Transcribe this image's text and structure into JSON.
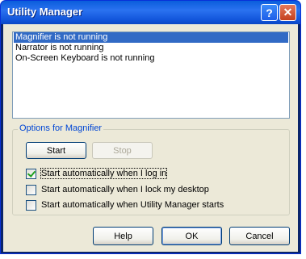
{
  "window": {
    "title": "Utility Manager",
    "help_glyph": "?",
    "close_glyph": "✕"
  },
  "list": {
    "items": [
      "Magnifier is not running",
      "Narrator is not running",
      "On-Screen Keyboard is not running"
    ],
    "selected_index": 0
  },
  "options": {
    "group_label": "Options for Magnifier",
    "start_label": "Start",
    "stop_label": "Stop",
    "checkboxes": [
      {
        "label": "Start automatically when I log in",
        "checked": true
      },
      {
        "label": "Start automatically when I lock my desktop",
        "checked": false
      },
      {
        "label": "Start automatically when Utility Manager starts",
        "checked": false
      }
    ]
  },
  "buttons": {
    "help": "Help",
    "ok": "OK",
    "cancel": "Cancel"
  },
  "colors": {
    "selection": "#316ac5",
    "group_label": "#0046d5",
    "check_mark": "#21a121"
  }
}
